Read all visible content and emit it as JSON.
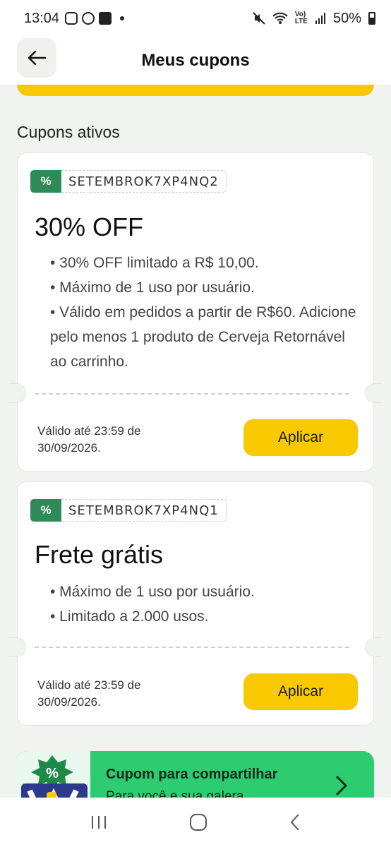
{
  "status_bar": {
    "time": "13:04",
    "battery": "50%"
  },
  "header": {
    "title": "Meus cupons"
  },
  "section": {
    "title": "Cupons ativos"
  },
  "coupons": [
    {
      "code": "SETEMBROK7XP4NQ2",
      "badge": "%",
      "title": "30% OFF",
      "rules": [
        "• 30% OFF limitado a R$ 10,00.",
        "• Máximo de 1 uso por usuário.",
        "• Válido em pedidos a partir de R$60. Adicione pelo menos 1 produto de Cerveja Retornável ao carrinho."
      ],
      "valid": "Válido até 23:59 de 30/09/2026.",
      "button": "Aplicar"
    },
    {
      "code": "SETEMBROK7XP4NQ1",
      "badge": "%",
      "title": "Frete grátis",
      "rules": [
        "• Máximo de 1 uso por usuário.",
        "• Limitado a 2.000 usos."
      ],
      "valid": "Válido até 23:59 de 30/09/2026.",
      "button": "Aplicar"
    }
  ],
  "share_banner": {
    "title": "Cupom para compartilhar",
    "subtitle": "Para você e sua galera"
  },
  "colors": {
    "accent_yellow": "#f8c900",
    "badge_green": "#2e8b57",
    "banner_green": "#2ecc71"
  }
}
